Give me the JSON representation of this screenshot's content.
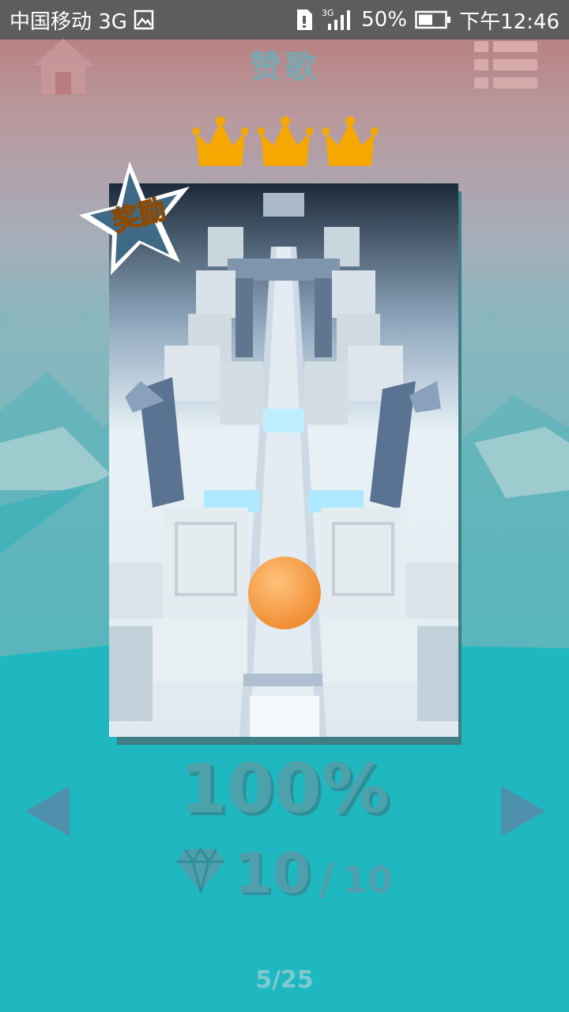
{
  "status_bar": {
    "carrier": "中国移动 3G",
    "network_type": "3G",
    "battery": "50%",
    "time": "下午12:46"
  },
  "header": {
    "title": "赞歌",
    "home_icon": "home-icon",
    "menu_icon": "list-menu-icon",
    "crowns_earned": 3,
    "crown_color": "#f5a800"
  },
  "level_card": {
    "badge_text": "奖励",
    "preview": "level-preview-image"
  },
  "stats": {
    "progress": "100%",
    "gems_collected": "10",
    "gems_separator": "/",
    "gems_total": "10"
  },
  "navigation": {
    "prev_icon": "triangle-left-icon",
    "next_icon": "triangle-right-icon",
    "page": "5/25"
  },
  "colors": {
    "accent_teal": "#1fb8c0",
    "text_teal": "#4da1ab"
  }
}
